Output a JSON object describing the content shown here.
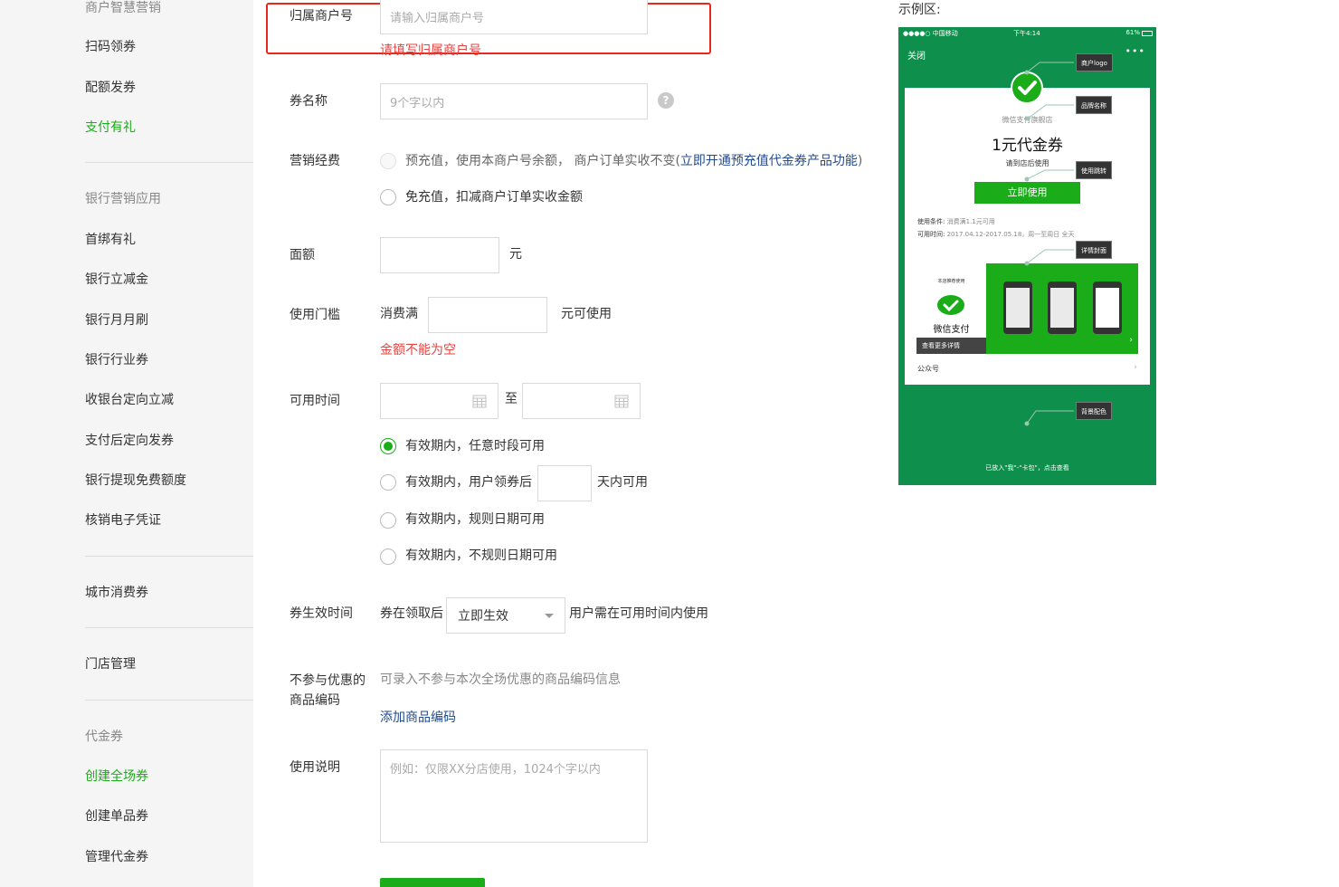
{
  "sidebar": {
    "top_partial": "商户智慧营销",
    "items_a": [
      "扫码领券",
      "配额发券",
      "支付有礼"
    ],
    "group_bank": "银行营销应用",
    "items_b": [
      "首绑有礼",
      "银行立减金",
      "银行月月刷",
      "银行行业券",
      "收银台定向立减",
      "支付后定向发券",
      "银行提现免费额度",
      "核销电子凭证"
    ],
    "item_city": "城市消费券",
    "item_store": "门店管理",
    "group_voucher": "代金券",
    "items_c": [
      "创建全场券",
      "创建单品券",
      "管理代金券"
    ],
    "active_color": "#1aad19"
  },
  "form": {
    "merchant": {
      "label": "归属商户号",
      "placeholder": "请输入归属商户号",
      "error": "请填写归属商户号"
    },
    "name": {
      "label": "券名称",
      "placeholder": "9个字以内",
      "help": "?"
    },
    "budget": {
      "label": "营销经费",
      "opt1_text": "预充值，使用本商户号余额， 商户订单实收不变(",
      "opt1_link": "立即开通预充值代金券产品功能",
      "opt1_end": ")",
      "opt2": "免充值，扣减商户订单实收金额"
    },
    "amount": {
      "label": "面额",
      "unit": "元"
    },
    "threshold": {
      "label": "使用门槛",
      "prefix": "消费满",
      "suffix": "元可使用",
      "error": "金额不能为空"
    },
    "time": {
      "label": "可用时间",
      "to": "至",
      "opt1": "有效期内，任意时段可用",
      "opt2_pre": "有效期内，用户领券后",
      "opt2_post": "天内可用",
      "opt3": "有效期内，规则日期可用",
      "opt4": "有效期内，不规则日期可用"
    },
    "effect": {
      "label": "券生效时间",
      "prefix": "券在领取后",
      "selected": "立即生效",
      "suffix": "用户需在可用时间内使用"
    },
    "exclude": {
      "label_line1": "不参与优惠的",
      "label_line2": "商品编码",
      "hint": "可录入不参与本次全场优惠的商品编码信息",
      "add_link": "添加商品编码"
    },
    "desc": {
      "label": "使用说明",
      "placeholder": "例如：仅限XX分店使用，1024个字以内"
    },
    "error_color": "#e64340",
    "link_color": "#224b8f"
  },
  "example": {
    "label": "示例区:",
    "status_carrier": "●●●●○ 中国移动",
    "status_time": "下午4:14",
    "status_right": "61%",
    "close": "关闭",
    "more": "•••",
    "shop": "微信支付旗舰店",
    "title": "1元代金券",
    "subtitle": "请到店后使用",
    "use_btn": "立即使用",
    "cond_label": "使用条件:",
    "cond_value": "消费满1.1元可用",
    "time_label": "可用时间:",
    "time_value": "2017.04.12-2017.05.18，周一至周日 全天",
    "banner_top": "本店推荐使用",
    "banner_brand": "微信支付",
    "banner_more": "查看更多详情",
    "row_label": "公众号",
    "tags": {
      "logo": "商户logo",
      "brand": "品牌名称",
      "jump": "使用跳转",
      "cover": "详情封面",
      "bg": "背景配色"
    },
    "bottom": "已放入\"我\"-\"卡包\"，点击查看",
    "bg_color": "#0e8f4b"
  }
}
